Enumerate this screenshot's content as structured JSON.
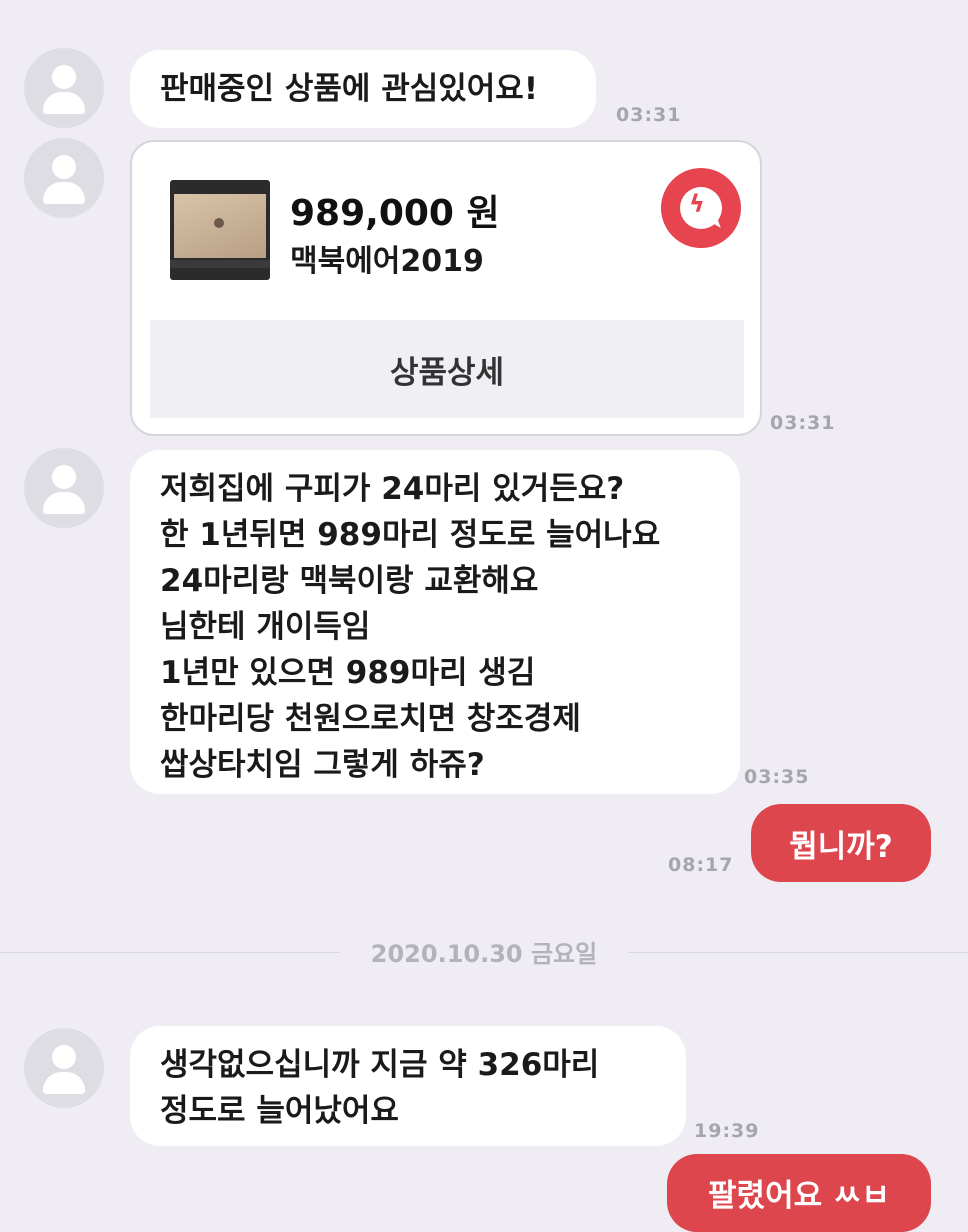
{
  "colors": {
    "background": "#efedf3",
    "sent_bubble": "#dd464d",
    "badge": "#e6454f",
    "time": "#a6a5ac"
  },
  "messages": [
    {
      "text": "판매중인 상품에 관심있어요!",
      "time": "03:31"
    },
    {
      "card": {
        "price": "989,000 원",
        "name": "맥북에어2019",
        "button": "상품상세",
        "badge_icon": "lightning-talk-icon"
      },
      "time": "03:31"
    },
    {
      "lines": [
        "저희집에 구피가 24마리 있거든요?",
        "한 1년뒤면 989마리 정도로 늘어나요",
        "24마리랑 맥북이랑 교환해요",
        "님한테 개이득임",
        "1년만 있으면 989마리 생김",
        "한마리당 천원으로치면 창조경제",
        "쌉상타치임  그렇게 하쥬?"
      ],
      "time": "03:35"
    },
    {
      "sent": "뭡니까?",
      "time": "08:17"
    },
    {
      "date": "2020.10.30 금요일"
    },
    {
      "lines": [
        "생각없으십니까 지금 약 326마리",
        "정도로 늘어났어요"
      ],
      "time": "19:39"
    },
    {
      "sent": "팔렸어요 ㅆㅂ"
    }
  ]
}
